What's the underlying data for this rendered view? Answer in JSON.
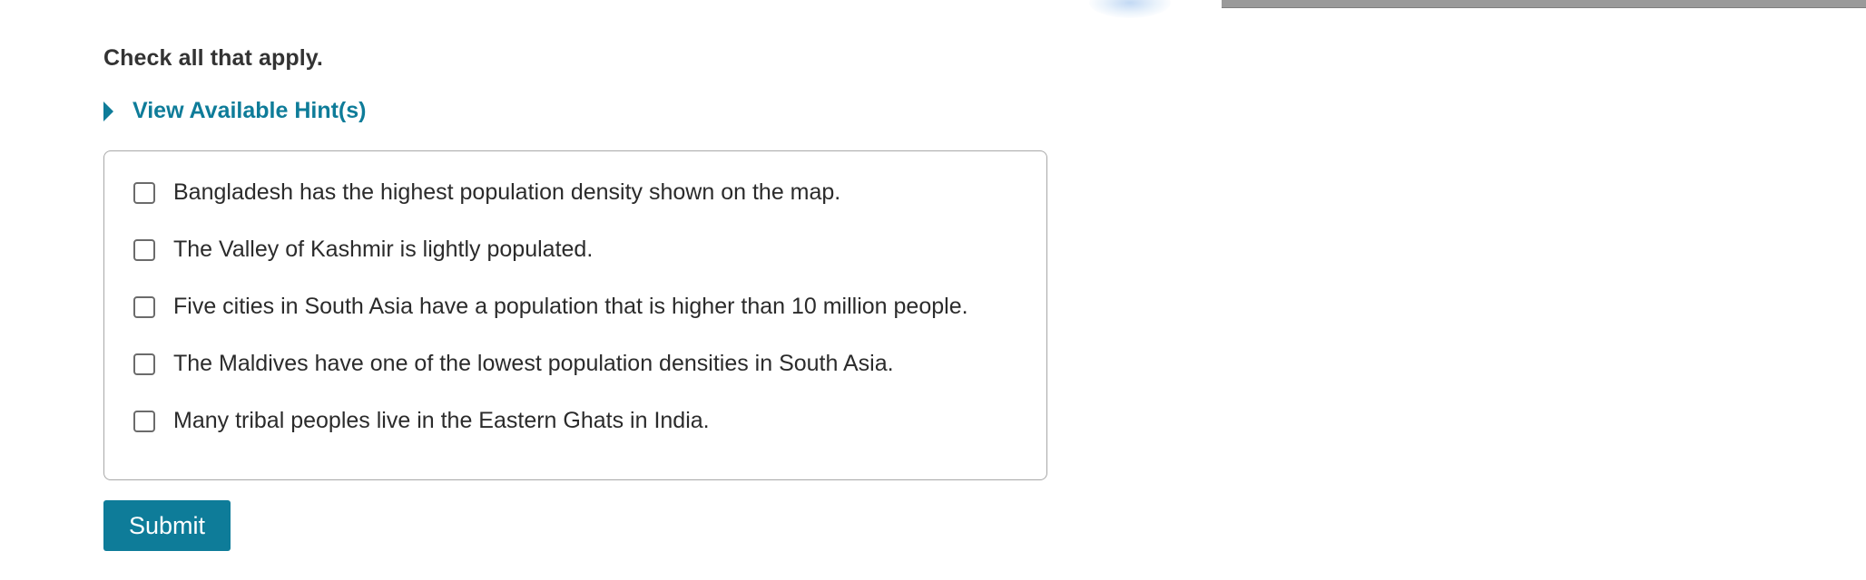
{
  "question": {
    "instruction": "Check all that apply.",
    "hint_label": "View Available Hint(s)",
    "options": [
      {
        "text": "Bangladesh has the highest population density shown on the map.",
        "checked": false
      },
      {
        "text": "The Valley of Kashmir is lightly populated.",
        "checked": false
      },
      {
        "text": "Five cities in South Asia have a population that is higher than 10 million people.",
        "checked": false
      },
      {
        "text": "The Maldives have one of the lowest population densities in South Asia.",
        "checked": false
      },
      {
        "text": "Many tribal peoples live in the Eastern Ghats in India.",
        "checked": false
      }
    ],
    "submit_label": "Submit"
  },
  "colors": {
    "accent": "#0e7c99",
    "text": "#2b2b2b",
    "border": "#a8a8a8"
  },
  "icons": {
    "hint_toggle": "caret-right-icon",
    "option_box": "checkbox-icon"
  }
}
